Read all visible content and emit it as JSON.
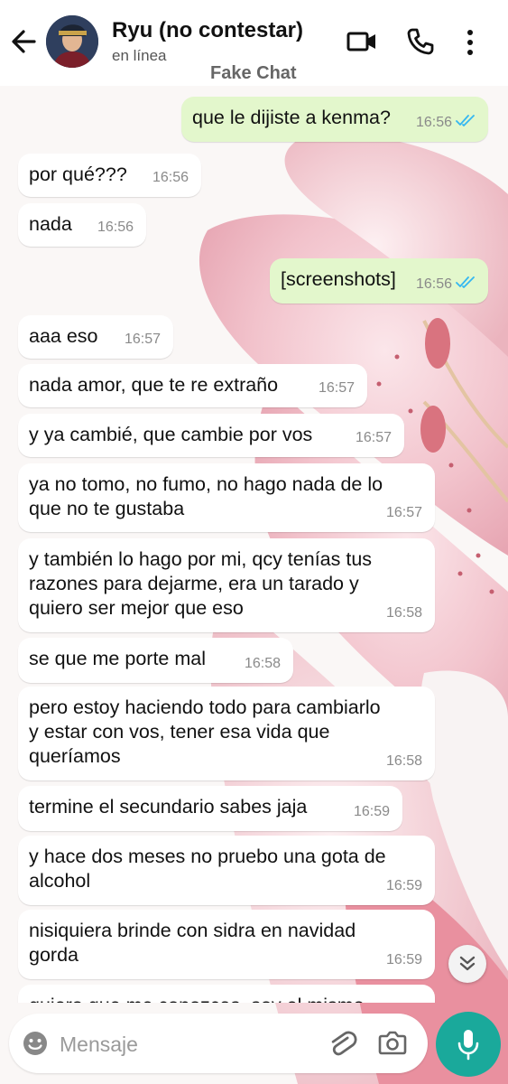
{
  "header": {
    "contact_name": "Ryu (no contestar)",
    "status": "en línea",
    "app_label": "Fake Chat",
    "icons": [
      "back-arrow-icon",
      "video-call-icon",
      "phone-icon",
      "more-vert-icon"
    ]
  },
  "messages": [
    {
      "dir": "out",
      "text": "que le dijiste a kenma?",
      "time": "16:56",
      "read": true
    },
    {
      "dir": "in",
      "text": "por qué???",
      "time": "16:56"
    },
    {
      "dir": "in",
      "text": "nada",
      "time": "16:56"
    },
    {
      "dir": "out",
      "text": "[screenshots]",
      "time": "16:56",
      "read": true
    },
    {
      "dir": "in",
      "text": "aaa eso",
      "time": "16:57"
    },
    {
      "dir": "in",
      "text": "nada amor, que te re extraño",
      "time": "16:57"
    },
    {
      "dir": "in",
      "text": "y ya cambié, que cambie por vos",
      "time": "16:57"
    },
    {
      "dir": "in",
      "text": "ya no tomo, no fumo, no hago nada de lo\nque no te gustaba",
      "time": "16:57"
    },
    {
      "dir": "in",
      "text": "y también lo hago por mi, qcy tenías tus\nrazones para dejarme, era un tarado y\nquiero ser mejor que eso",
      "time": "16:58"
    },
    {
      "dir": "in",
      "text": "se que me porte mal",
      "time": "16:58"
    },
    {
      "dir": "in",
      "text": "pero estoy haciendo todo para cambiarlo\ny estar con vos, tener esa vida que\nqueríamos",
      "time": "16:58"
    },
    {
      "dir": "in",
      "text": "termine el secundario sabes jaja",
      "time": "16:59"
    },
    {
      "dir": "in",
      "text": "y hace dos meses no pruebo una gota de\nalcohol",
      "time": "16:59"
    },
    {
      "dir": "in",
      "text": "nisiquiera brinde con sidra en navidad\ngorda",
      "time": "16:59"
    },
    {
      "dir": "in",
      "text": "quiero que me conozcas, soy el mismo",
      "time": ""
    }
  ],
  "composer": {
    "placeholder": "Mensaje",
    "icons": [
      "emoji-icon",
      "attach-icon",
      "camera-icon",
      "mic-icon"
    ]
  },
  "scroll_down_icon": "double-chevron-down-icon",
  "colors": {
    "outgoing_bubble": "#e3f7cc",
    "incoming_bubble": "#ffffff",
    "read_ticks": "#34b7f1",
    "mic_button": "#1aa99b"
  }
}
